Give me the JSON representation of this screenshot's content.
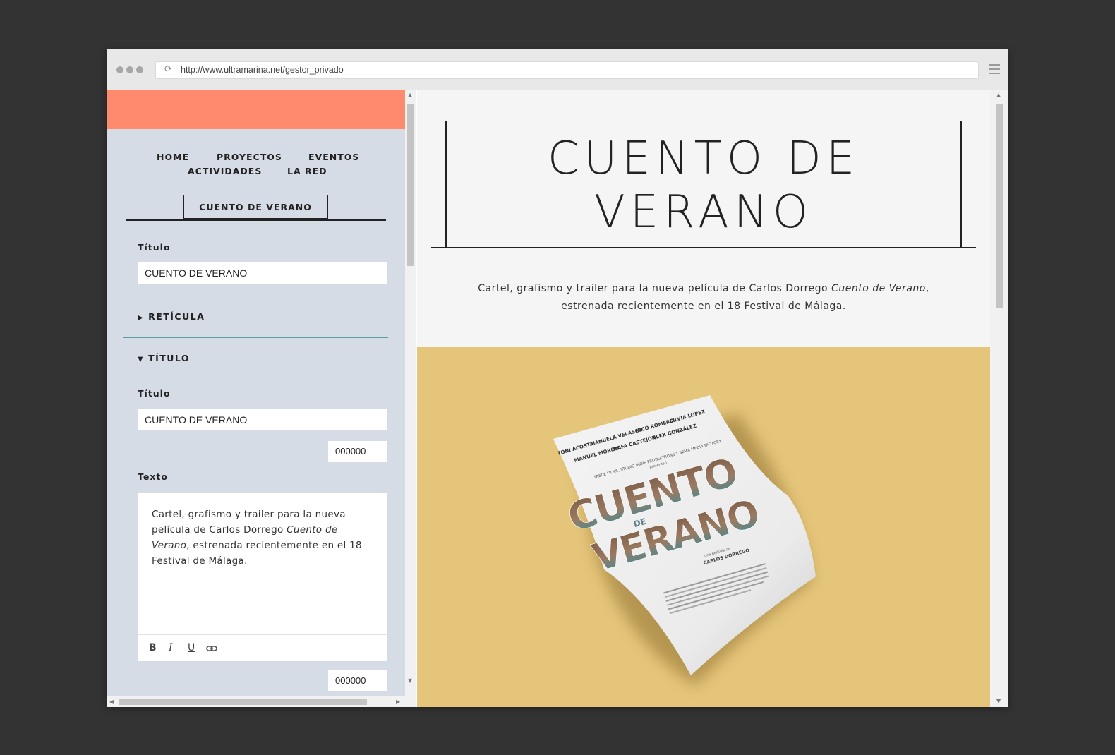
{
  "browser": {
    "url": "http://www.ultramarina.net/gestor_privado"
  },
  "editor": {
    "nav": {
      "home": "HOME",
      "proyectos": "PROYECTOS",
      "eventos": "EVENTOS",
      "actividades": "ACTIVIDADES",
      "la_red": "LA RED"
    },
    "active_tab": "CUENTO DE VERANO",
    "title_label": "Título",
    "title_value": "CUENTO DE VERANO",
    "section_reticula": "RETÍCULA",
    "section_titulo": "TÍTULO",
    "titulo_label": "Título",
    "titulo_value": "CUENTO DE VERANO",
    "titulo_color": "000000",
    "texto_label": "Texto",
    "texto_part1": "Cartel, grafismo y trailer para la nueva película de Carlos Dorrego ",
    "texto_italic": "Cuento de Verano",
    "texto_part2": ", estrenada recientemente en el 18 Festival de Málaga.",
    "texto_color": "000000",
    "toolbar": {
      "bold": "B",
      "italic": "I",
      "underline": "U"
    }
  },
  "preview": {
    "title_line1": "CUENTO DE",
    "title_line2": "VERANO",
    "desc_part1": "Cartel, grafismo y trailer para la nueva película de Carlos Dorrego ",
    "desc_italic": "Cuento de Verano",
    "desc_part2": ",",
    "desc_line2": "estrenada recientemente en el 18 Festival de Málaga."
  },
  "poster": {
    "actors_row1": [
      "TONI ACOSTA",
      "MANUELA VELASCO",
      "NICO ROMERO",
      "SILVIA LÓPEZ"
    ],
    "actors_row2": [
      "MANUEL MORÓN",
      "RAFA CASTEJÓN",
      "ÁLEX GONZÁLEZ"
    ],
    "producers": "TRECE FILMS, STUDIO INDIE PRODUCTIONS Y SEMA MEDIA FACTORY",
    "presents": "presentan",
    "title_top": "CUENTO",
    "title_de": "DE",
    "title_bottom": "VERANO",
    "director_prefix": "una película de",
    "director": "CARLOS DORREGO"
  },
  "colors": {
    "accent": "#ff8a6d",
    "editor_bg": "#d6dce6",
    "teal_divider": "#5a9ea4",
    "poster_bg": "#e5c57a",
    "page_bg": "#333333"
  }
}
